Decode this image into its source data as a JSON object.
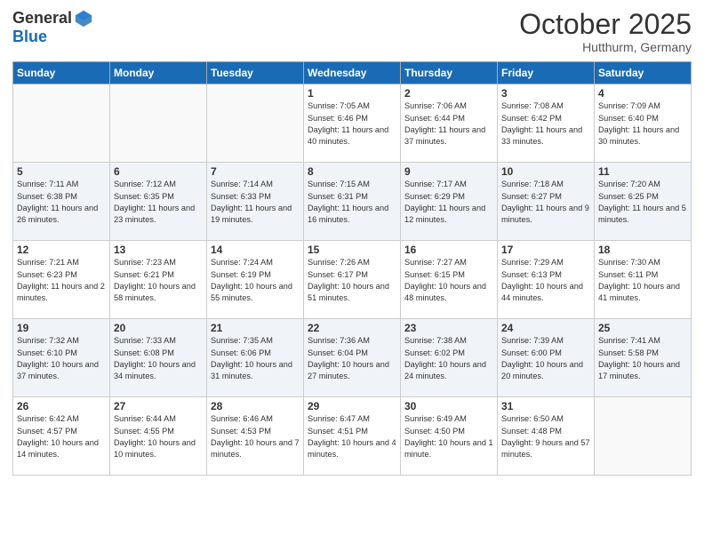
{
  "header": {
    "logo_general": "General",
    "logo_blue": "Blue",
    "month": "October 2025",
    "location": "Hutthurm, Germany"
  },
  "days_of_week": [
    "Sunday",
    "Monday",
    "Tuesday",
    "Wednesday",
    "Thursday",
    "Friday",
    "Saturday"
  ],
  "weeks": [
    [
      {
        "day": "",
        "info": ""
      },
      {
        "day": "",
        "info": ""
      },
      {
        "day": "",
        "info": ""
      },
      {
        "day": "1",
        "info": "Sunrise: 7:05 AM\nSunset: 6:46 PM\nDaylight: 11 hours\nand 40 minutes."
      },
      {
        "day": "2",
        "info": "Sunrise: 7:06 AM\nSunset: 6:44 PM\nDaylight: 11 hours\nand 37 minutes."
      },
      {
        "day": "3",
        "info": "Sunrise: 7:08 AM\nSunset: 6:42 PM\nDaylight: 11 hours\nand 33 minutes."
      },
      {
        "day": "4",
        "info": "Sunrise: 7:09 AM\nSunset: 6:40 PM\nDaylight: 11 hours\nand 30 minutes."
      }
    ],
    [
      {
        "day": "5",
        "info": "Sunrise: 7:11 AM\nSunset: 6:38 PM\nDaylight: 11 hours\nand 26 minutes."
      },
      {
        "day": "6",
        "info": "Sunrise: 7:12 AM\nSunset: 6:35 PM\nDaylight: 11 hours\nand 23 minutes."
      },
      {
        "day": "7",
        "info": "Sunrise: 7:14 AM\nSunset: 6:33 PM\nDaylight: 11 hours\nand 19 minutes."
      },
      {
        "day": "8",
        "info": "Sunrise: 7:15 AM\nSunset: 6:31 PM\nDaylight: 11 hours\nand 16 minutes."
      },
      {
        "day": "9",
        "info": "Sunrise: 7:17 AM\nSunset: 6:29 PM\nDaylight: 11 hours\nand 12 minutes."
      },
      {
        "day": "10",
        "info": "Sunrise: 7:18 AM\nSunset: 6:27 PM\nDaylight: 11 hours\nand 9 minutes."
      },
      {
        "day": "11",
        "info": "Sunrise: 7:20 AM\nSunset: 6:25 PM\nDaylight: 11 hours\nand 5 minutes."
      }
    ],
    [
      {
        "day": "12",
        "info": "Sunrise: 7:21 AM\nSunset: 6:23 PM\nDaylight: 11 hours\nand 2 minutes."
      },
      {
        "day": "13",
        "info": "Sunrise: 7:23 AM\nSunset: 6:21 PM\nDaylight: 10 hours\nand 58 minutes."
      },
      {
        "day": "14",
        "info": "Sunrise: 7:24 AM\nSunset: 6:19 PM\nDaylight: 10 hours\nand 55 minutes."
      },
      {
        "day": "15",
        "info": "Sunrise: 7:26 AM\nSunset: 6:17 PM\nDaylight: 10 hours\nand 51 minutes."
      },
      {
        "day": "16",
        "info": "Sunrise: 7:27 AM\nSunset: 6:15 PM\nDaylight: 10 hours\nand 48 minutes."
      },
      {
        "day": "17",
        "info": "Sunrise: 7:29 AM\nSunset: 6:13 PM\nDaylight: 10 hours\nand 44 minutes."
      },
      {
        "day": "18",
        "info": "Sunrise: 7:30 AM\nSunset: 6:11 PM\nDaylight: 10 hours\nand 41 minutes."
      }
    ],
    [
      {
        "day": "19",
        "info": "Sunrise: 7:32 AM\nSunset: 6:10 PM\nDaylight: 10 hours\nand 37 minutes."
      },
      {
        "day": "20",
        "info": "Sunrise: 7:33 AM\nSunset: 6:08 PM\nDaylight: 10 hours\nand 34 minutes."
      },
      {
        "day": "21",
        "info": "Sunrise: 7:35 AM\nSunset: 6:06 PM\nDaylight: 10 hours\nand 31 minutes."
      },
      {
        "day": "22",
        "info": "Sunrise: 7:36 AM\nSunset: 6:04 PM\nDaylight: 10 hours\nand 27 minutes."
      },
      {
        "day": "23",
        "info": "Sunrise: 7:38 AM\nSunset: 6:02 PM\nDaylight: 10 hours\nand 24 minutes."
      },
      {
        "day": "24",
        "info": "Sunrise: 7:39 AM\nSunset: 6:00 PM\nDaylight: 10 hours\nand 20 minutes."
      },
      {
        "day": "25",
        "info": "Sunrise: 7:41 AM\nSunset: 5:58 PM\nDaylight: 10 hours\nand 17 minutes."
      }
    ],
    [
      {
        "day": "26",
        "info": "Sunrise: 6:42 AM\nSunset: 4:57 PM\nDaylight: 10 hours\nand 14 minutes."
      },
      {
        "day": "27",
        "info": "Sunrise: 6:44 AM\nSunset: 4:55 PM\nDaylight: 10 hours\nand 10 minutes."
      },
      {
        "day": "28",
        "info": "Sunrise: 6:46 AM\nSunset: 4:53 PM\nDaylight: 10 hours\nand 7 minutes."
      },
      {
        "day": "29",
        "info": "Sunrise: 6:47 AM\nSunset: 4:51 PM\nDaylight: 10 hours\nand 4 minutes."
      },
      {
        "day": "30",
        "info": "Sunrise: 6:49 AM\nSunset: 4:50 PM\nDaylight: 10 hours\nand 1 minute."
      },
      {
        "day": "31",
        "info": "Sunrise: 6:50 AM\nSunset: 4:48 PM\nDaylight: 9 hours\nand 57 minutes."
      },
      {
        "day": "",
        "info": ""
      }
    ]
  ]
}
